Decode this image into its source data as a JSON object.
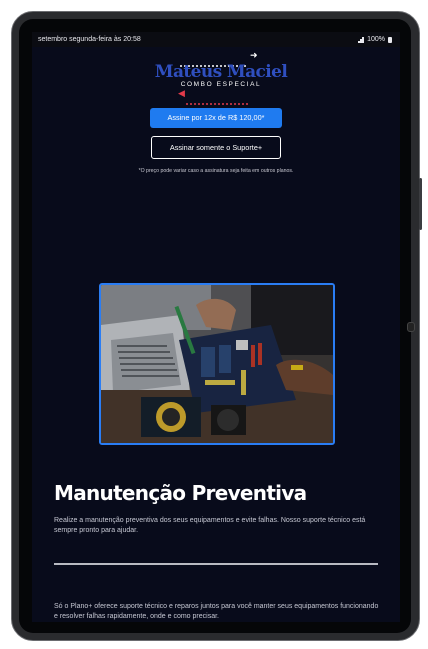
{
  "status_bar": {
    "time_text": "setembro segunda-feira às 20:58",
    "battery_text": "100%",
    "icons": [
      "signal-icon",
      "battery-icon"
    ]
  },
  "header": {
    "logo_title": "Mateus Maciel",
    "logo_subtitle": "COMBO ESPECIAL"
  },
  "cta": {
    "primary_label": "Assine por 12x de R$ 120,00*",
    "secondary_label": "Assinar somente o Suporte+",
    "note": "*O preço pode variar caso a assinatura seja feita em outros planos."
  },
  "section": {
    "title": "Manutenção Preventiva",
    "description": "Realize a manutenção preventiva dos seus equipamentos e evite falhas. Nosso suporte técnico está sempre pronto para ajudar.",
    "bottom_text": "Só o Plano+ oferece suporte técnico e reparos juntos para você manter seus equipamentos funcionando e resolver falhas rapidamente, onde e como precisar."
  },
  "colors": {
    "page_bg": "#080b1b",
    "accent_blue": "#1f7bf0",
    "logo_blue": "#2f4fbf",
    "accent_red": "#e23a4a"
  }
}
